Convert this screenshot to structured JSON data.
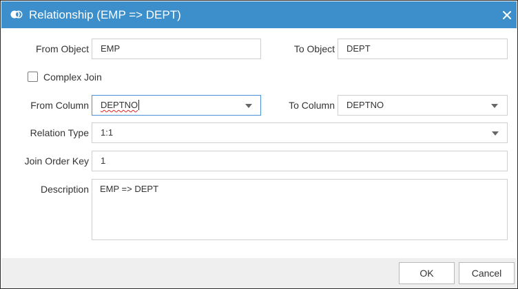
{
  "dialog": {
    "title": "Relationship (EMP => DEPT)",
    "colors": {
      "titlebar": "#3c8fcb",
      "focus_border": "#4a90d9",
      "footer": "#efefef"
    }
  },
  "form": {
    "from_object": {
      "label": "From Object",
      "value": "EMP"
    },
    "to_object": {
      "label": "To Object",
      "value": "DEPT"
    },
    "complex_join": {
      "label": "Complex Join",
      "checked": false
    },
    "from_column": {
      "label": "From Column",
      "value": "DEPTNO"
    },
    "to_column": {
      "label": "To Column",
      "value": "DEPTNO"
    },
    "relation_type": {
      "label": "Relation Type",
      "value": "1:1"
    },
    "join_order_key": {
      "label": "Join Order Key",
      "value": "1"
    },
    "description": {
      "label": "Description",
      "value": "EMP => DEPT"
    }
  },
  "buttons": {
    "ok": "OK",
    "cancel": "Cancel"
  },
  "icons": {
    "title": "relationship-icon",
    "close": "close-icon",
    "dropdown": "chevron-down-icon"
  }
}
